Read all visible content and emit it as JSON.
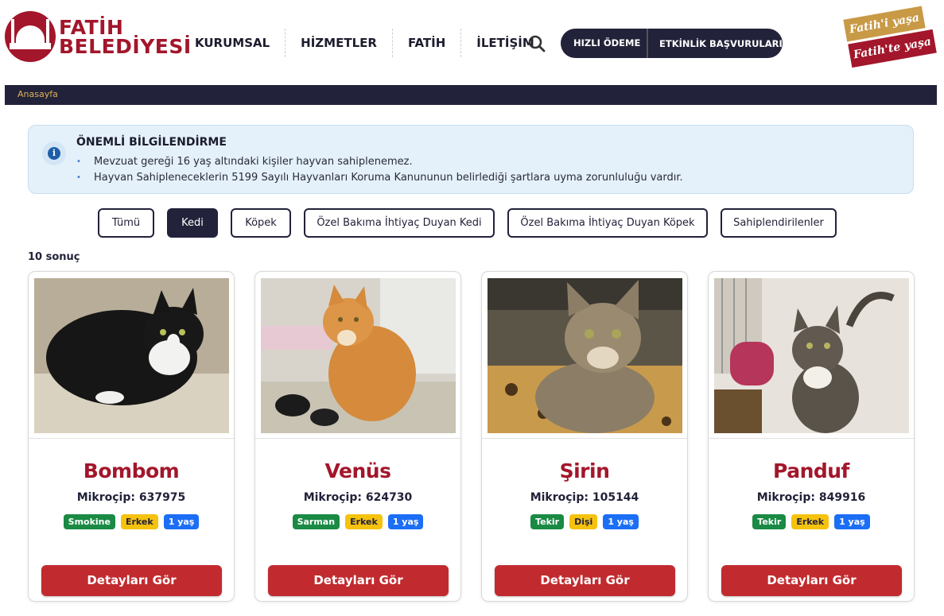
{
  "header": {
    "logo_line1": "FATİH",
    "logo_line2": "BELEDİYESİ",
    "nav": [
      "KURUMSAL",
      "HİZMETLER",
      "FATİH",
      "İLETİŞİM"
    ],
    "quick_pay": "HIZLI ÖDEME",
    "events": "ETKİNLİK BAŞVURULARI",
    "slogan_line1": "Fatih'i yaşa",
    "slogan_line2": "Fatih'te yaşa"
  },
  "breadcrumb": {
    "home": "Anasayfa"
  },
  "info": {
    "title": "ÖNEMLİ BİLGİLENDİRME",
    "items": [
      "Mevzuat gereği 16 yaş altındaki kişiler hayvan sahiplenemez.",
      "Hayvan Sahipleneceklerin 5199 Sayılı Hayvanları Koruma Kanununun belirlediği şartlara uyma zorunluluğu vardır."
    ]
  },
  "filters": [
    {
      "label": "Tümü",
      "active": false
    },
    {
      "label": "Kedi",
      "active": true
    },
    {
      "label": "Köpek",
      "active": false
    },
    {
      "label": "Özel Bakıma İhtiyaç Duyan Kedi",
      "active": false
    },
    {
      "label": "Özel Bakıma İhtiyaç Duyan Köpek",
      "active": false
    },
    {
      "label": "Sahiplendirilenler",
      "active": false
    }
  ],
  "result_count": "10 sonuç",
  "cards": [
    {
      "name": "Bombom",
      "chip": "Mikroçip: 637975",
      "tags": [
        "Smokine",
        "Erkek",
        "1 yaş"
      ],
      "button": "Detayları Gör"
    },
    {
      "name": "Venüs",
      "chip": "Mikroçip: 624730",
      "tags": [
        "Sarman",
        "Erkek",
        "1 yaş"
      ],
      "button": "Detayları Gör"
    },
    {
      "name": "Şirin",
      "chip": "Mikroçip: 105144",
      "tags": [
        "Tekir",
        "Dişi",
        "1 yaş"
      ],
      "button": "Detayları Gör"
    },
    {
      "name": "Panduf",
      "chip": "Mikroçip: 849916",
      "tags": [
        "Tekir",
        "Erkek",
        "1 yaş"
      ],
      "button": "Detayları Gör"
    }
  ],
  "colors": {
    "brand": "#a3162b",
    "dark": "#22223a",
    "button": "#c12b2f",
    "tag_breed": "#1a8a44",
    "tag_gender": "#f5c20e",
    "tag_age": "#1b6ef5"
  },
  "icons": {
    "search": "search-icon",
    "info": "info-icon"
  }
}
